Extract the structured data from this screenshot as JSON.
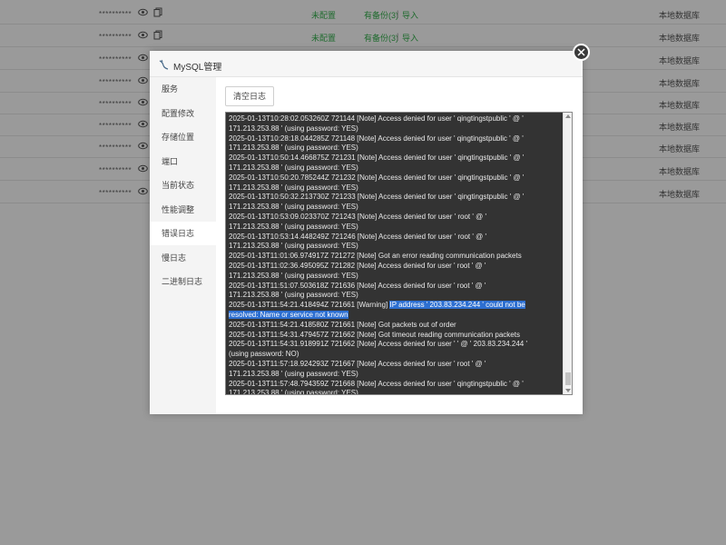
{
  "background_rows": [
    {
      "password": "**********",
      "config": "未配置",
      "backup": "有备份(3)",
      "import": "导入",
      "location": "本地数据库"
    },
    {
      "password": "**********",
      "config": "未配置",
      "backup": "有备份(3)",
      "import": "导入",
      "location": "本地数据库"
    },
    {
      "password": "**********",
      "config": "",
      "backup": "",
      "import": "",
      "location": "本地数据库"
    },
    {
      "password": "**********",
      "config": "",
      "backup": "",
      "import": "",
      "location": "本地数据库"
    },
    {
      "password": "**********",
      "config": "",
      "backup": "",
      "import": "",
      "location": "本地数据库"
    },
    {
      "password": "**********",
      "config": "",
      "backup": "",
      "import": "",
      "location": "本地数据库"
    },
    {
      "password": "**********",
      "config": "",
      "backup": "",
      "import": "",
      "location": "本地数据库"
    },
    {
      "password": "**********",
      "config": "",
      "backup": "",
      "import": "",
      "location": "本地数据库"
    },
    {
      "password": "**********",
      "config": "",
      "backup": "",
      "import": "",
      "location": "本地数据库"
    }
  ],
  "modal": {
    "title": "MySQL管理",
    "sidebar": [
      "服务",
      "配置修改",
      "存储位置",
      "端口",
      "当前状态",
      "性能调整",
      "错误日志",
      "慢日志",
      "二进制日志"
    ],
    "active_item": "错误日志",
    "clear_button": "清空日志"
  },
  "log_lines": [
    {
      "text": "2025-01-13T10:28:02.053260Z 721144 [Note] Access denied for user ' qingtingstpublic ' @ '"
    },
    {
      "text": "171.213.253.88 ' (using password: YES)"
    },
    {
      "text": "2025-01-13T10:28:18.044285Z 721148 [Note] Access denied for user ' qingtingstpublic ' @ '"
    },
    {
      "text": "171.213.253.88 ' (using password: YES)"
    },
    {
      "text": "2025-01-13T10:50:14.466875Z 721231 [Note] Access denied for user ' qingtingstpublic ' @ '"
    },
    {
      "text": "171.213.253.88 ' (using password: YES)"
    },
    {
      "text": "2025-01-13T10:50:20.785244Z 721232 [Note] Access denied for user ' qingtingstpublic ' @ '"
    },
    {
      "text": "171.213.253.88 ' (using password: YES)"
    },
    {
      "text": "2025-01-13T10:50:32.213730Z 721233 [Note] Access denied for user ' qingtingstpublic ' @ '"
    },
    {
      "text": "171.213.253.88 ' (using password: YES)"
    },
    {
      "text": "2025-01-13T10:53:09.023370Z 721243 [Note] Access denied for user ' root ' @ '"
    },
    {
      "text": "171.213.253.88 ' (using password: YES)"
    },
    {
      "text": "2025-01-13T10:53:14.448249Z 721246 [Note] Access denied for user ' root ' @ '"
    },
    {
      "text": "171.213.253.88 ' (using password: YES)"
    },
    {
      "text": "2025-01-13T11:01:06.974917Z 721272 [Note] Got an error reading communication packets"
    },
    {
      "text": "2025-01-13T11:02:36.495095Z 721282 [Note] Access denied for user ' root ' @ '"
    },
    {
      "text": "171.213.253.88 ' (using password: YES)"
    },
    {
      "text": "2025-01-13T11:51:07.503618Z 721636 [Note] Access denied for user ' root ' @ '"
    },
    {
      "text": "171.213.253.88 ' (using password: YES)"
    },
    {
      "text": "2025-01-13T11:54:21.418494Z 721661 [Warning] ",
      "highlight": "IP address ' 203.83.234.244 ' could not be"
    },
    {
      "text": "",
      "highlight": "resolved: Name or service not known"
    },
    {
      "text": "2025-01-13T11:54:21.418580Z 721661 [Note] Got packets out of order"
    },
    {
      "text": "2025-01-13T11:54:31.479457Z 721662 [Note] Got timeout reading communication packets"
    },
    {
      "text": "2025-01-13T11:54:31.918991Z 721662 [Note] Access denied for user ' ' @ ' 203.83.234.244 '"
    },
    {
      "text": "(using password: NO)"
    },
    {
      "text": "2025-01-13T11:57:18.924293Z 721667 [Note] Access denied for user ' root ' @ '"
    },
    {
      "text": "171.213.253.88 ' (using password: YES)"
    },
    {
      "text": "2025-01-13T11:57:48.794359Z 721668 [Note] Access denied for user ' qingtingstpublic ' @ '"
    },
    {
      "text": "171.213.253.88 ' (using password: YES)"
    }
  ]
}
